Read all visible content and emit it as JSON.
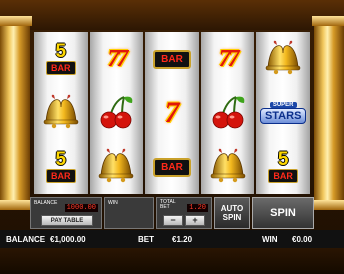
{
  "reels": [
    [
      "5bar",
      "bell",
      "5bar"
    ],
    [
      "77",
      "cherries",
      "bell"
    ],
    [
      "bar",
      "7",
      "bar"
    ],
    [
      "77",
      "cherries",
      "bell"
    ],
    [
      "bell",
      "superstars",
      "5bar"
    ]
  ],
  "symbols": {
    "five_bar_number": "5",
    "bar_text": "BAR",
    "seven": "7",
    "double_seven": "77",
    "superstars_top": "SUPER",
    "superstars_main": "STARS"
  },
  "panel": {
    "balance_label": "BALANCE",
    "balance_digits": "1000.00",
    "paytable_label": "PAY TABLE",
    "win_label": "WIN",
    "total_bet_label": "TOTAL BET",
    "total_bet_digits": "1.20",
    "minus_label": "−",
    "plus_label": "+",
    "autospin_label": "AUTO SPIN",
    "spin_label": "SPIN"
  },
  "status": {
    "balance_label": "BALANCE",
    "balance_value": "€1,000.00",
    "bet_label": "BET",
    "bet_value": "€1.20",
    "win_label": "WIN",
    "win_value": "€0.00"
  }
}
